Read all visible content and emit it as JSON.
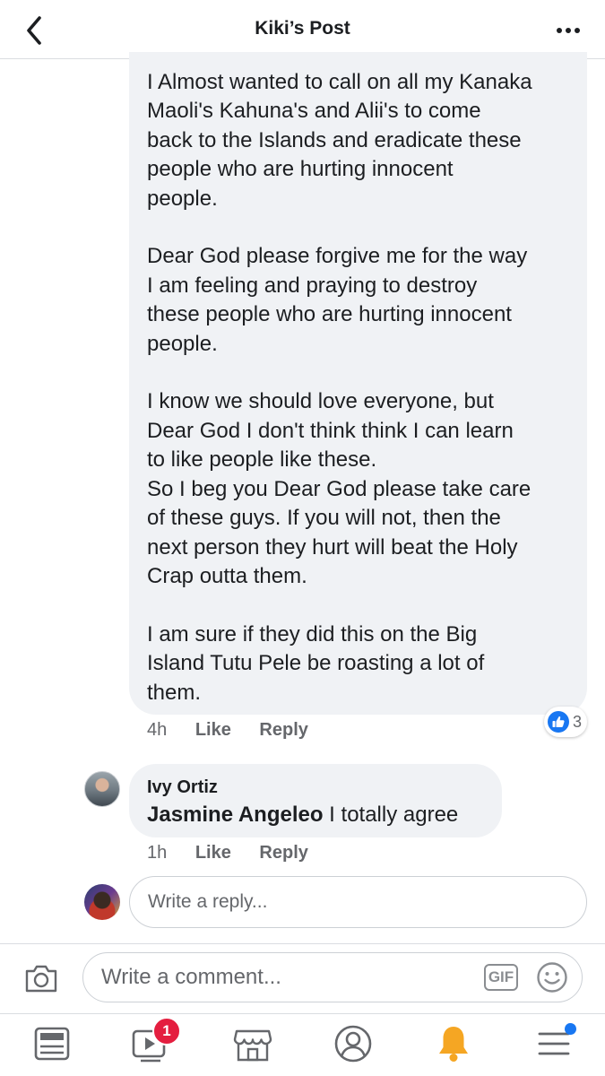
{
  "header": {
    "title": "Kiki’s Post"
  },
  "main_comment": {
    "text": "I Almost wanted to call on all my Kanaka\nMaoli's Kahuna's and Alii's to come\nback to the Islands and eradicate these\npeople who are hurting innocent\npeople.\n\nDear God please forgive me for the way\nI am feeling and praying to destroy\nthese people who are hurting innocent\npeople.\n\nI know we should love everyone, but\nDear God I don't think think I can learn\nto like people like these.\nSo I beg you Dear God please take care\nof these guys.  If you will not, then the\nnext person they hurt will beat the Holy\nCrap outta them.\n\nI am sure if they did this on the Big\nIsland Tutu Pele be roasting a lot of\nthem.",
    "time": "4h",
    "like_label": "Like",
    "reply_label": "Reply",
    "reaction_count": "3"
  },
  "reply": {
    "author": "Ivy Ortiz",
    "tag": "Jasmine Angeleo",
    "text": " I totally agree",
    "time": "1h",
    "like_label": "Like",
    "reply_label": "Reply"
  },
  "reply_box": {
    "placeholder": "Write a reply..."
  },
  "composer": {
    "placeholder": "Write a comment...",
    "gif_label": "GIF"
  },
  "tabbar": {
    "items": [
      "news-feed",
      "watch",
      "marketplace",
      "profile",
      "notifications",
      "menu"
    ],
    "watch_badge": "1"
  },
  "colors": {
    "accent": "#1877f2",
    "badge": "#e41e3f",
    "bubble": "#f0f2f5",
    "bell": "#f5a623"
  }
}
